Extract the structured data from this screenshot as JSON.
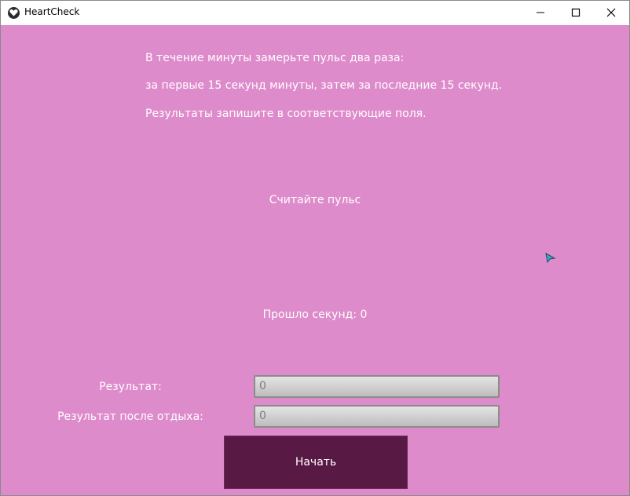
{
  "window": {
    "title": "HeartCheck"
  },
  "instructions": [
    "В течение минуты замерьте пульс два раза:",
    "за первые 15 секунд минуты, затем за последние 15 секунд.",
    "Результаты запишите в соответствующие поля."
  ],
  "status": "Считайте пульс",
  "timer": "Прошло секунд: 0",
  "form": {
    "result_label": "Результат:",
    "result_value": "0",
    "rest_label": "Результат после отдыха:",
    "rest_value": "0"
  },
  "start_label": "Начать",
  "icons": {
    "app": "heart-app-icon",
    "minimize": "minimize-icon",
    "maximize": "maximize-icon",
    "close": "close-icon",
    "cursor": "mouse-cursor-icon"
  },
  "colors": {
    "background": "#de8bcb",
    "button": "#581a45",
    "text": "#ffffff"
  }
}
